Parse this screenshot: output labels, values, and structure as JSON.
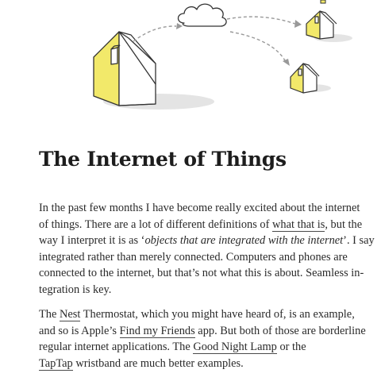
{
  "article": {
    "title": "The Internet of Things",
    "p1": {
      "l1": "In the past few months I have become really excited about the internet",
      "l2a": "of things. There are a lot of different definitions of ",
      "l2_link": "what that is",
      "l2b": ", but the",
      "l3a": "way I interpret it is as ‘",
      "l3_em": "objects that are integrated with the internet",
      "l3b": "’. I say",
      "l4": "integrated rather than merely connected. Computers and phones are",
      "l5": "connected to the internet, but that’s not what this is about. Seamless in-",
      "l6": "tegration is key."
    },
    "p2": {
      "l1a": "The ",
      "l1_link": "Nest",
      "l1b": " Thermostat, which you might have heard of, is an example,",
      "l2a": "and so is Apple’s ",
      "l2_link": "Find my Friends",
      "l2b": " app. But both of those are borderline",
      "l3a": "regular internet applications. The ",
      "l3_link": "Good Night Lamp",
      "l3b": " or the",
      "l4_link": "TapTap",
      "l4b": " wristband are much better examples."
    }
  },
  "colors": {
    "house_yellow": "#f2e96a",
    "house_stroke": "#333333",
    "shadow": "#e2e2e2",
    "arrow": "#999999",
    "text": "#2a2a2a"
  },
  "icons": [
    "house-icon",
    "cloud-icon",
    "dashed-arrow-icon"
  ]
}
